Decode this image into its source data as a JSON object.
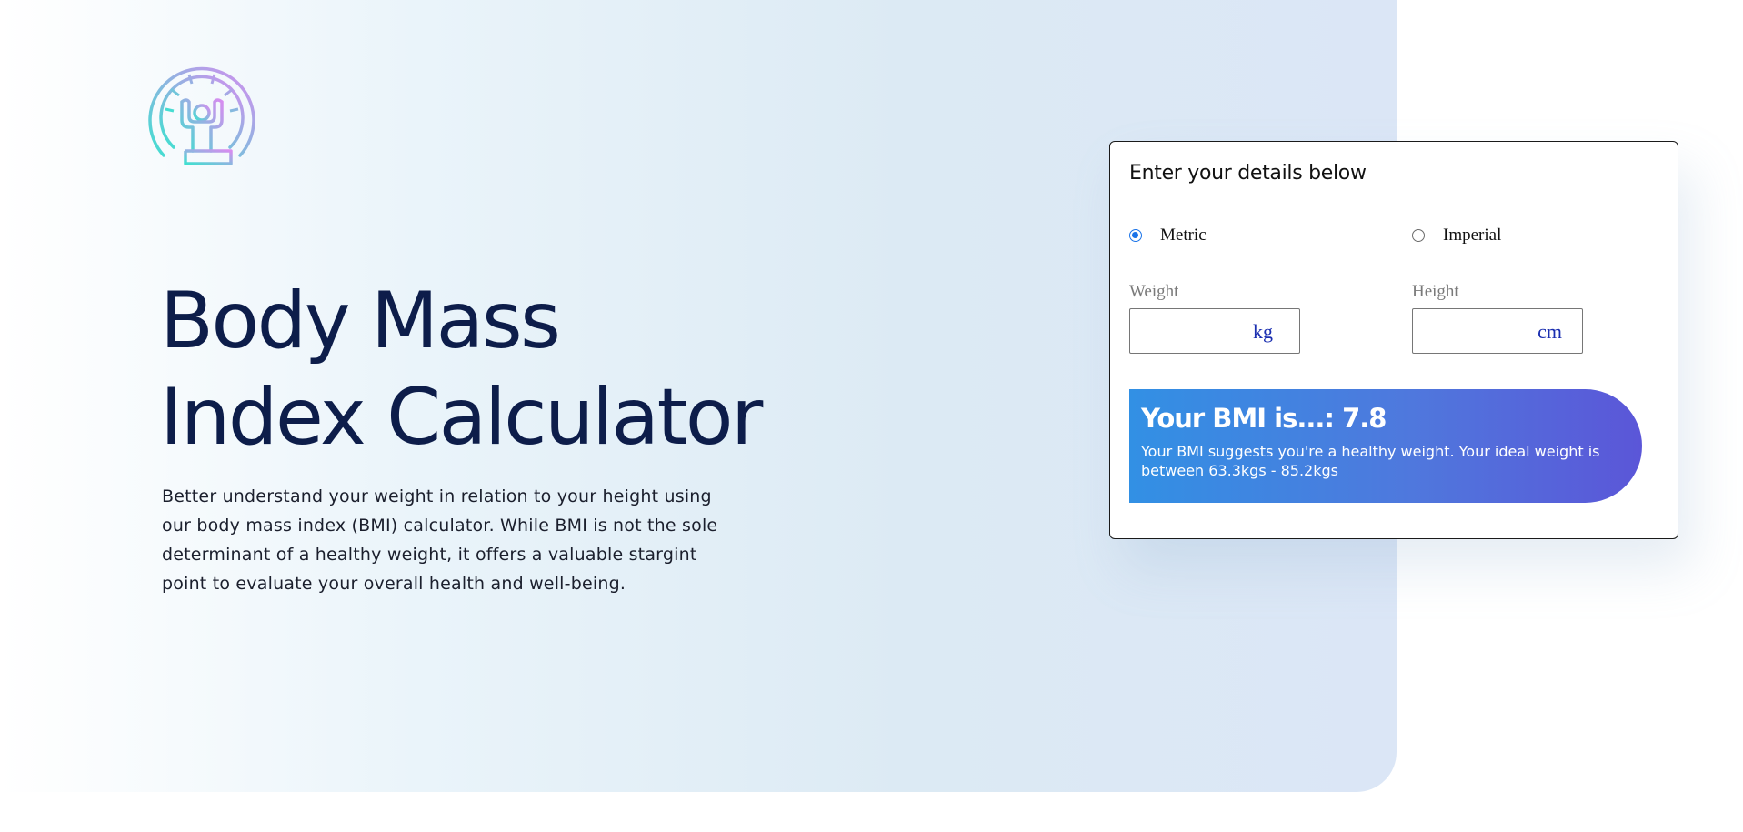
{
  "hero": {
    "logo_icon": "bmi-person-gauge-icon",
    "title_line1": "Body Mass",
    "title_line2": "Index Calculator",
    "description": "Better understand your weight in relation to your height using our body mass index (BMI) calculator. While BMI is not the sole determinant of a healthy weight, it offers a valuable stargint point to evaluate your overall health and well-being."
  },
  "calculator": {
    "heading": "Enter your details below",
    "units": [
      {
        "label": "Metric",
        "selected": true
      },
      {
        "label": "Imperial",
        "selected": false
      }
    ],
    "weight": {
      "label": "Weight",
      "value": "",
      "unit": "kg"
    },
    "height": {
      "label": "Height",
      "value": "",
      "unit": "cm"
    },
    "result": {
      "title": "Your BMI is...: 7.8",
      "description": "Your BMI suggests you're a healthy weight. Your ideal weight is between 63.3kgs - 85.2kgs"
    }
  },
  "colors": {
    "title": "#0d1d4a",
    "accent": "#1a73e8",
    "result_gradient_start": "#3290e4",
    "result_gradient_end": "#5b56d8",
    "logo_gradient_start": "#3fe0d0",
    "logo_gradient_end": "#d88cf0"
  }
}
